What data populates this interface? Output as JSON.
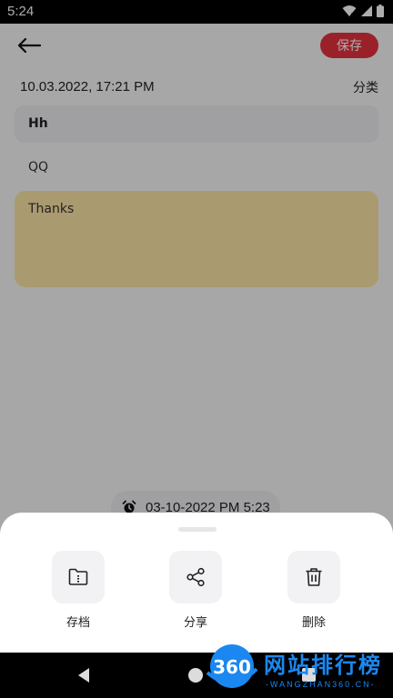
{
  "status_bar": {
    "time": "5:24",
    "icons": [
      "wifi-icon",
      "signal-icon",
      "battery-icon"
    ]
  },
  "top_bar": {
    "back_icon": "arrow-left-icon",
    "save_label": "保存"
  },
  "note": {
    "date": "10.03.2022, 17:21 PM",
    "category_label": "分类",
    "title": "Hh",
    "subtitle": "QQ",
    "body": "Thanks",
    "reminder": {
      "icon": "alarm-clock-icon",
      "text": "03-10-2022 PM 5:23"
    }
  },
  "bottom_sheet": {
    "actions": [
      {
        "label": "存档",
        "icon": "archive-folder-icon"
      },
      {
        "label": "分享",
        "icon": "share-icon"
      },
      {
        "label": "删除",
        "icon": "trash-icon"
      }
    ]
  },
  "watermark": {
    "number": "360",
    "cn_text": "网站排行榜",
    "en_text": "-WANGZHAN360.CN-"
  },
  "colors": {
    "accent": "#e3323e",
    "note_body": "#fbe4a4",
    "watermark_blue": "#1a88f0"
  }
}
